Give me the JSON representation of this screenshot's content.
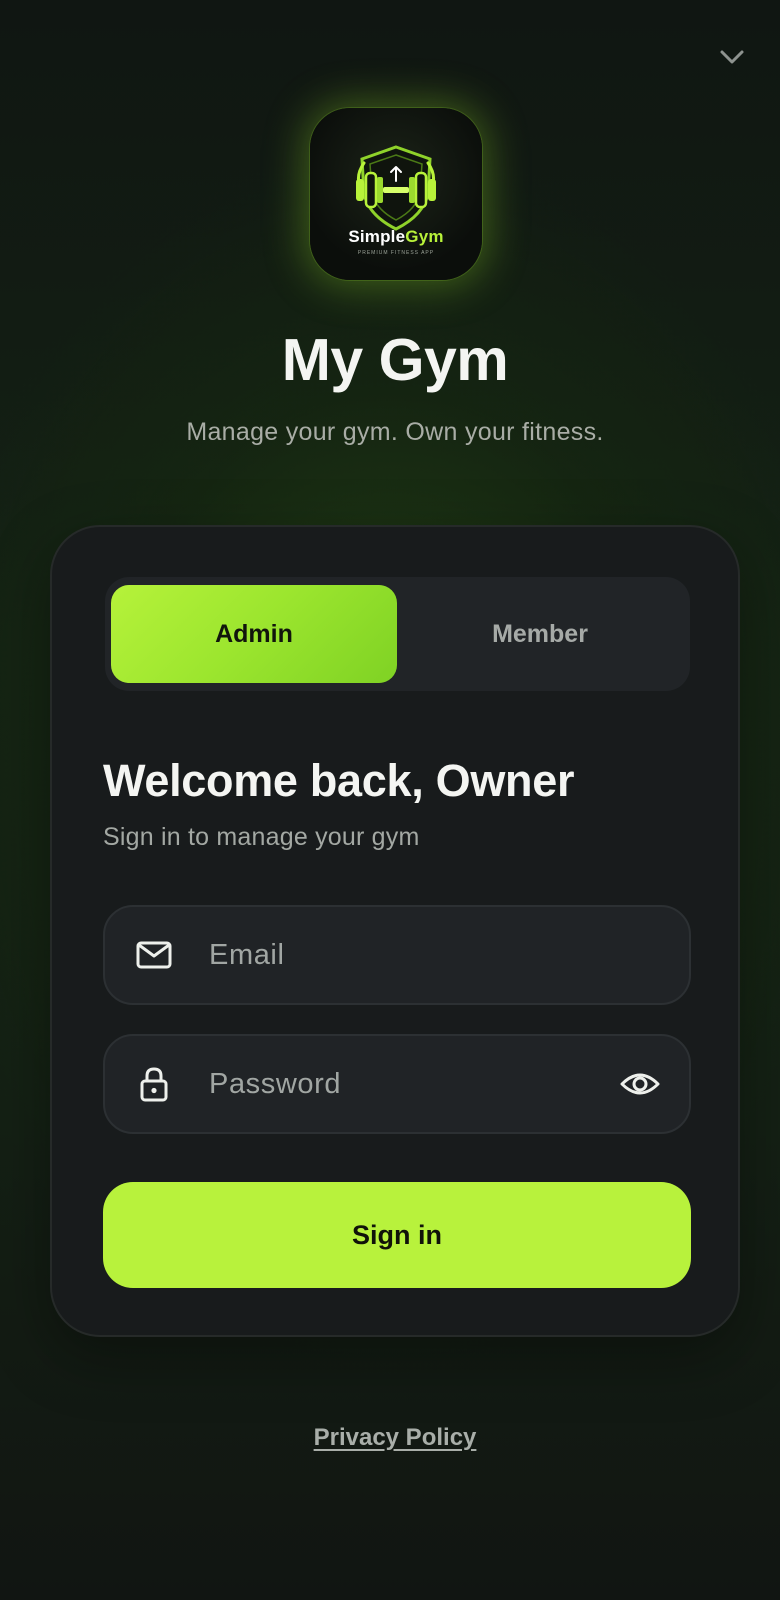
{
  "header": {
    "collapse_icon": "chevron-down-icon"
  },
  "logo": {
    "brand_word_1": "Simple",
    "brand_word_2": "Gym",
    "tagline": "PREMIUM FITNESS APP",
    "icon": "dumbbell-shield-icon",
    "accent_color": "#b8f23a"
  },
  "app": {
    "title": "My Gym",
    "subtitle": "Manage your gym. Own your fitness."
  },
  "role_toggle": {
    "options": [
      "Admin",
      "Member"
    ],
    "selected": "Admin"
  },
  "login": {
    "heading": "Welcome back, Owner",
    "subheading": "Sign in to manage your gym",
    "email": {
      "placeholder": "Email",
      "value": "",
      "icon": "mail-icon"
    },
    "password": {
      "placeholder": "Password",
      "value": "",
      "icon": "lock-icon",
      "toggle_icon": "eye-icon"
    },
    "submit_label": "Sign in"
  },
  "footer": {
    "privacy_label": "Privacy Policy"
  },
  "colors": {
    "accent": "#b8f23c",
    "card": "#181b1c",
    "field": "#202326"
  }
}
